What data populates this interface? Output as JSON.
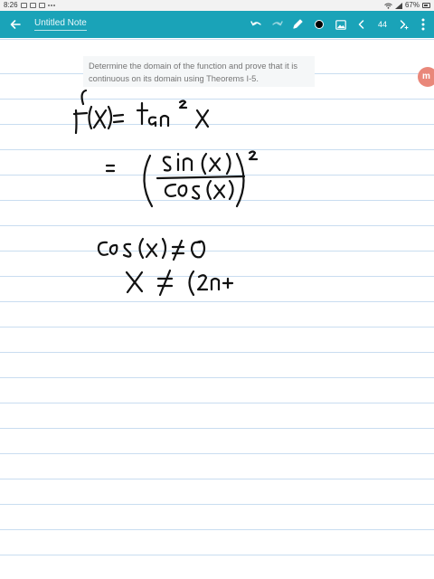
{
  "status_bar": {
    "time": "8:26",
    "battery": "67%"
  },
  "app_bar": {
    "title": "Untitled Note",
    "page_number": "44",
    "pen_color": "#000000",
    "accent_color": "#1aa3b8"
  },
  "question": {
    "text": "Determine the domain of the function and prove that it is continuous on its domain using Theorems I-5."
  },
  "brand": {
    "badge_letter": "m",
    "badge_color": "#e9877a"
  },
  "icons": {
    "back": "arrow-back-icon",
    "undo": "undo-icon",
    "redo": "redo-icon",
    "pen": "pen-icon",
    "color": "color-dot-icon",
    "image": "image-icon",
    "prev": "chevron-left-icon",
    "next": "chevron-right-icon",
    "more": "more-icon"
  }
}
